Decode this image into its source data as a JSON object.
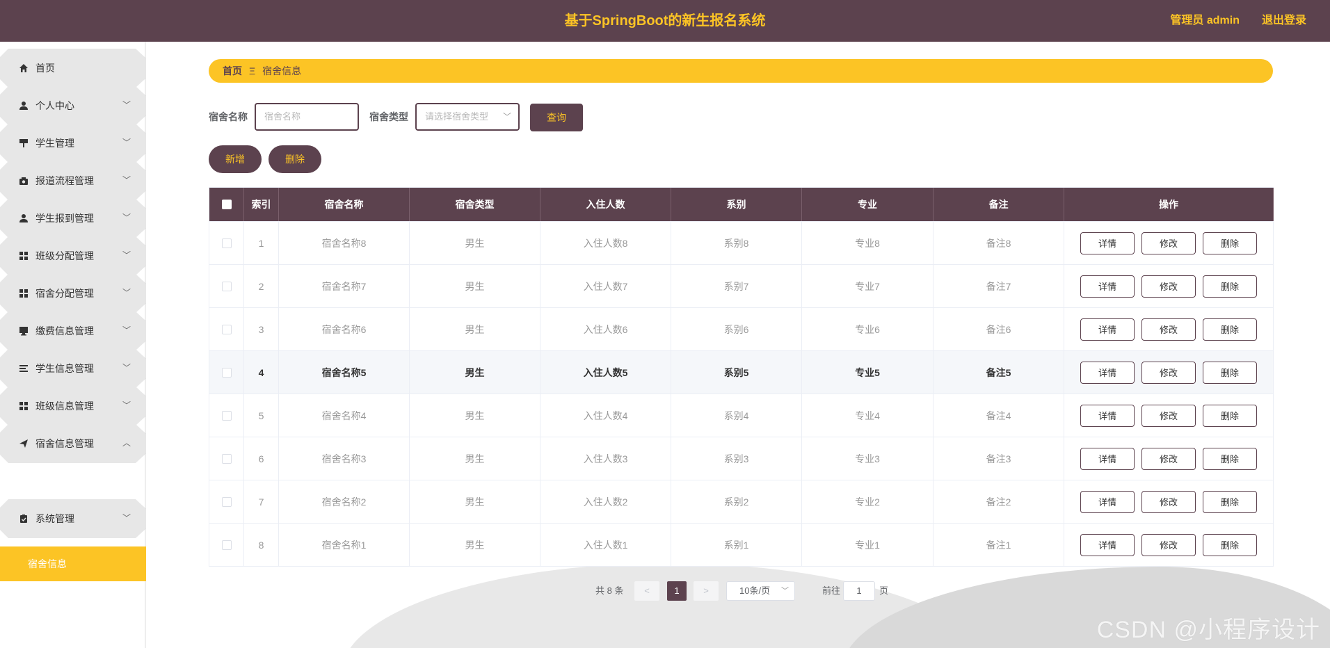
{
  "header": {
    "title": "基于SpringBoot的新生报名系统",
    "user": "管理员 admin",
    "logout": "退出登录"
  },
  "sidebar": {
    "items": [
      {
        "label": "首页",
        "icon": "home-icon",
        "arrow": ""
      },
      {
        "label": "个人中心",
        "icon": "user-icon",
        "arrow": "﹀"
      },
      {
        "label": "学生管理",
        "icon": "flag-icon",
        "arrow": "﹀"
      },
      {
        "label": "报道流程管理",
        "icon": "camera-icon",
        "arrow": "﹀"
      },
      {
        "label": "学生报到管理",
        "icon": "user-icon",
        "arrow": "﹀"
      },
      {
        "label": "班级分配管理",
        "icon": "grid-icon",
        "arrow": "﹀"
      },
      {
        "label": "宿舍分配管理",
        "icon": "grid-icon",
        "arrow": "﹀"
      },
      {
        "label": "缴费信息管理",
        "icon": "monitor-icon",
        "arrow": "﹀"
      },
      {
        "label": "学生信息管理",
        "icon": "list-icon",
        "arrow": "﹀"
      },
      {
        "label": "班级信息管理",
        "icon": "grid-icon",
        "arrow": "﹀"
      },
      {
        "label": "宿舍信息管理",
        "icon": "send-icon",
        "arrow": "︿"
      },
      {
        "label": "系统管理",
        "icon": "clipboard-icon",
        "arrow": "﹀"
      }
    ],
    "active_sub": "宿舍信息"
  },
  "breadcrumb": {
    "home": "首页",
    "separator": "Ξ",
    "current": "宿舍信息"
  },
  "search": {
    "name_label": "宿舍名称",
    "name_placeholder": "宿舍名称",
    "type_label": "宿舍类型",
    "type_placeholder": "请选择宿舍类型",
    "query": "查询"
  },
  "toolbar": {
    "add": "新增",
    "delete": "删除"
  },
  "table": {
    "headers": [
      "索引",
      "宿舍名称",
      "宿舍类型",
      "入住人数",
      "系别",
      "专业",
      "备注",
      "操作"
    ],
    "rows": [
      [
        "1",
        "宿舍名称8",
        "男生",
        "入住人数8",
        "系别8",
        "专业8",
        "备注8"
      ],
      [
        "2",
        "宿舍名称7",
        "男生",
        "入住人数7",
        "系别7",
        "专业7",
        "备注7"
      ],
      [
        "3",
        "宿舍名称6",
        "男生",
        "入住人数6",
        "系别6",
        "专业6",
        "备注6"
      ],
      [
        "4",
        "宿舍名称5",
        "男生",
        "入住人数5",
        "系别5",
        "专业5",
        "备注5"
      ],
      [
        "5",
        "宿舍名称4",
        "男生",
        "入住人数4",
        "系别4",
        "专业4",
        "备注4"
      ],
      [
        "6",
        "宿舍名称3",
        "男生",
        "入住人数3",
        "系别3",
        "专业3",
        "备注3"
      ],
      [
        "7",
        "宿舍名称2",
        "男生",
        "入住人数2",
        "系别2",
        "专业2",
        "备注2"
      ],
      [
        "8",
        "宿舍名称1",
        "男生",
        "入住人数1",
        "系别1",
        "专业1",
        "备注1"
      ]
    ],
    "highlight_row": 3,
    "actions": [
      "详情",
      "修改",
      "删除"
    ]
  },
  "pagination": {
    "total": "共 8 条",
    "prev": "<",
    "current": "1",
    "next": ">",
    "page_size": "10条/页",
    "goto_prefix": "前往",
    "goto_value": "1",
    "goto_suffix": "页"
  },
  "watermark": "CSDN @小程序设计",
  "colors": {
    "primary": "#5c424e",
    "accent": "#fcc425",
    "menu_bg": "#e7e7e7"
  }
}
